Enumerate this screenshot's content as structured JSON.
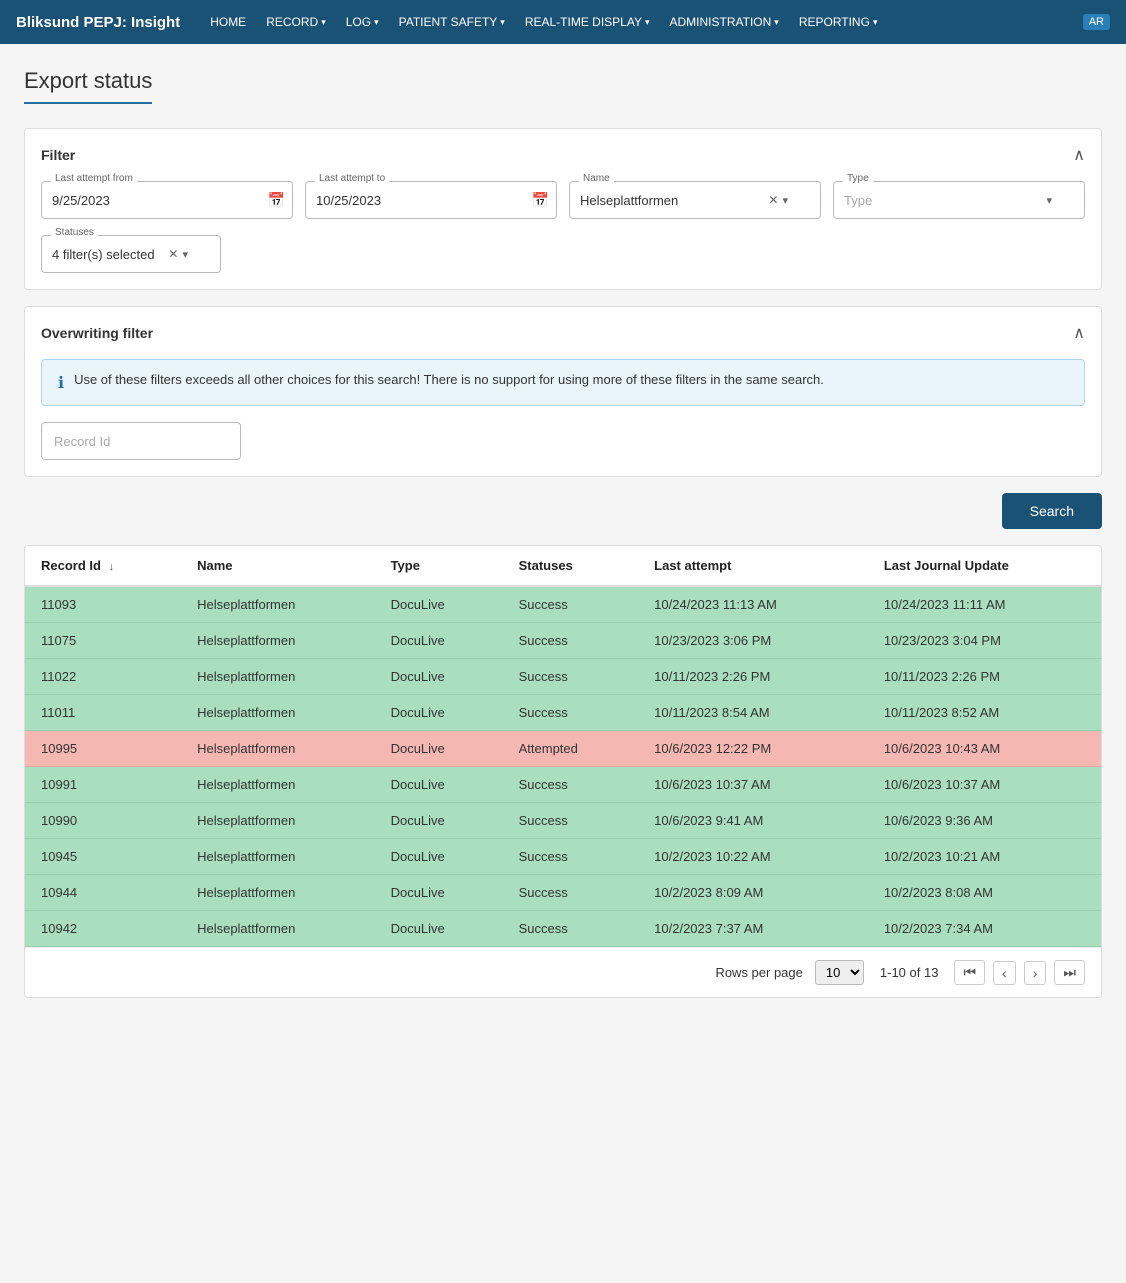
{
  "app": {
    "brand": "Bliksund PEPJ: Insight",
    "badge": "AR"
  },
  "nav": {
    "items": [
      {
        "label": "HOME",
        "hasDropdown": false
      },
      {
        "label": "RECORD",
        "hasDropdown": true
      },
      {
        "label": "LOG",
        "hasDropdown": true
      },
      {
        "label": "PATIENT SAFETY",
        "hasDropdown": true
      },
      {
        "label": "REAL-TIME DISPLAY",
        "hasDropdown": true
      },
      {
        "label": "ADMINISTRATION",
        "hasDropdown": true
      },
      {
        "label": "REPORTING",
        "hasDropdown": true
      }
    ]
  },
  "page": {
    "title": "Export status"
  },
  "filter": {
    "section_title": "Filter",
    "last_attempt_from_label": "Last attempt from",
    "last_attempt_from_value": "9/25/2023",
    "last_attempt_to_label": "Last attempt to",
    "last_attempt_to_value": "10/25/2023",
    "name_label": "Name",
    "name_value": "Helseplattformen",
    "type_label": "Type",
    "type_placeholder": "Type",
    "statuses_label": "Statuses",
    "statuses_value": "4 filter(s) selected"
  },
  "overwriting_filter": {
    "section_title": "Overwriting filter",
    "info_text": "Use of these filters exceeds all other choices for this search! There is no support for using more of these filters in the same search.",
    "record_id_placeholder": "Record Id"
  },
  "search_button": "Search",
  "table": {
    "columns": [
      {
        "label": "Record Id",
        "sortable": true
      },
      {
        "label": "Name",
        "sortable": false
      },
      {
        "label": "Type",
        "sortable": false
      },
      {
        "label": "Statuses",
        "sortable": false
      },
      {
        "label": "Last attempt",
        "sortable": false
      },
      {
        "label": "Last Journal Update",
        "sortable": false
      }
    ],
    "rows": [
      {
        "record_id": "11093",
        "name": "Helseplattformen",
        "type": "DocuLive",
        "status": "Success",
        "last_attempt": "10/24/2023 11:13 AM",
        "last_journal": "10/24/2023 11:11 AM",
        "row_class": "row-success"
      },
      {
        "record_id": "11075",
        "name": "Helseplattformen",
        "type": "DocuLive",
        "status": "Success",
        "last_attempt": "10/23/2023 3:06 PM",
        "last_journal": "10/23/2023 3:04 PM",
        "row_class": "row-success"
      },
      {
        "record_id": "11022",
        "name": "Helseplattformen",
        "type": "DocuLive",
        "status": "Success",
        "last_attempt": "10/11/2023 2:26 PM",
        "last_journal": "10/11/2023 2:26 PM",
        "row_class": "row-success"
      },
      {
        "record_id": "11011",
        "name": "Helseplattformen",
        "type": "DocuLive",
        "status": "Success",
        "last_attempt": "10/11/2023 8:54 AM",
        "last_journal": "10/11/2023 8:52 AM",
        "row_class": "row-success"
      },
      {
        "record_id": "10995",
        "name": "Helseplattformen",
        "type": "DocuLive",
        "status": "Attempted",
        "last_attempt": "10/6/2023 12:22 PM",
        "last_journal": "10/6/2023 10:43 AM",
        "row_class": "row-attempted"
      },
      {
        "record_id": "10991",
        "name": "Helseplattformen",
        "type": "DocuLive",
        "status": "Success",
        "last_attempt": "10/6/2023 10:37 AM",
        "last_journal": "10/6/2023 10:37 AM",
        "row_class": "row-success"
      },
      {
        "record_id": "10990",
        "name": "Helseplattformen",
        "type": "DocuLive",
        "status": "Success",
        "last_attempt": "10/6/2023 9:41 AM",
        "last_journal": "10/6/2023 9:36 AM",
        "row_class": "row-success"
      },
      {
        "record_id": "10945",
        "name": "Helseplattformen",
        "type": "DocuLive",
        "status": "Success",
        "last_attempt": "10/2/2023 10:22 AM",
        "last_journal": "10/2/2023 10:21 AM",
        "row_class": "row-success"
      },
      {
        "record_id": "10944",
        "name": "Helseplattformen",
        "type": "DocuLive",
        "status": "Success",
        "last_attempt": "10/2/2023 8:09 AM",
        "last_journal": "10/2/2023 8:08 AM",
        "row_class": "row-success"
      },
      {
        "record_id": "10942",
        "name": "Helseplattformen",
        "type": "DocuLive",
        "status": "Success",
        "last_attempt": "10/2/2023 7:37 AM",
        "last_journal": "10/2/2023 7:34 AM",
        "row_class": "row-success"
      }
    ]
  },
  "pagination": {
    "rows_per_page_label": "Rows per page",
    "rows_per_page": "10",
    "page_info": "1-10 of 13",
    "first_page_title": "First page",
    "prev_page_title": "Previous page",
    "next_page_title": "Next page",
    "last_page_title": "Last page"
  }
}
